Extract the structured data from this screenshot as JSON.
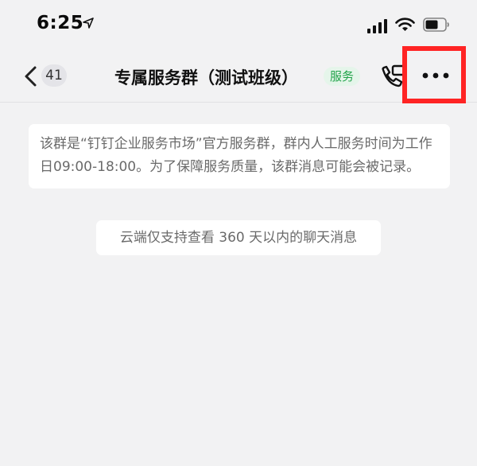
{
  "status_bar": {
    "time": "6:25"
  },
  "nav": {
    "unread_count": "41",
    "title": "专属服务群（测试班级）",
    "tag": "服务"
  },
  "messages": {
    "system_notice": "该群是“钉钉企业服务市场”官方服务群，群内人工服务时间为工作日09:00-18:00。为了保障服务质量，该群消息可能会被记录。",
    "history_notice": "云端仅支持查看 360 天以内的聊天消息"
  },
  "colors": {
    "background": "#f2f2f3",
    "tag_green": "#22a34a",
    "highlight_red": "#ff2424"
  },
  "icons": {
    "location": "location-arrow-icon",
    "signal": "cellular-signal-icon",
    "wifi": "wifi-icon",
    "battery": "battery-icon",
    "back": "chevron-left-icon",
    "phone": "phone-icon",
    "more": "more-dots-icon"
  }
}
